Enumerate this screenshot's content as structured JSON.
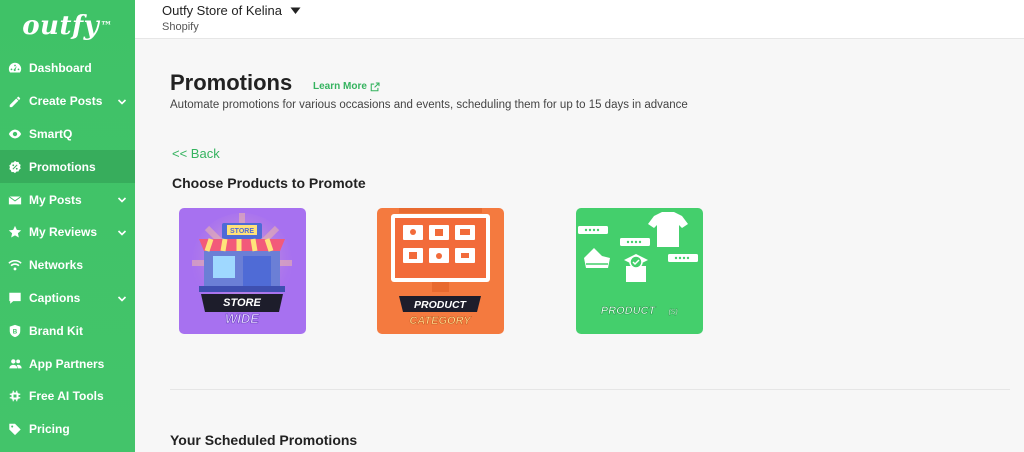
{
  "brand": {
    "logo_text": "outfy",
    "tm": "™"
  },
  "sidebar": {
    "items": [
      {
        "label": "Dashboard",
        "icon": "speedometer-icon",
        "has_chevron": false
      },
      {
        "label": "Create Posts",
        "icon": "pencil-icon",
        "has_chevron": true
      },
      {
        "label": "SmartQ",
        "icon": "smartq-icon",
        "has_chevron": false
      },
      {
        "label": "Promotions",
        "icon": "percent-badge-icon",
        "has_chevron": false,
        "active": true
      },
      {
        "label": "My Posts",
        "icon": "envelope-icon",
        "has_chevron": true
      },
      {
        "label": "My Reviews",
        "icon": "star-icon",
        "has_chevron": true
      },
      {
        "label": "Networks",
        "icon": "wifi-icon",
        "has_chevron": false
      },
      {
        "label": "Captions",
        "icon": "chat-icon",
        "has_chevron": true
      },
      {
        "label": "Brand Kit",
        "icon": "shield-icon",
        "has_chevron": false
      },
      {
        "label": "App Partners",
        "icon": "users-icon",
        "has_chevron": false
      },
      {
        "label": "Free AI Tools",
        "icon": "chip-icon",
        "has_chevron": false
      },
      {
        "label": "Pricing",
        "icon": "tag-icon",
        "has_chevron": false
      }
    ]
  },
  "topbar": {
    "store_name": "Outfy Store of Kelina",
    "platform": "Shopify"
  },
  "main": {
    "title": "Promotions",
    "learn_more": "Learn More",
    "subtitle": "Automate promotions for various occasions and events, scheduling them for up to 15 days in advance",
    "back": "<< Back",
    "section_heading": "Choose Products to Promote",
    "cards": [
      {
        "line1": "STORE",
        "line2": "WIDE",
        "sign": "STORE",
        "color": "#a771f0"
      },
      {
        "line1": "PRODUCT",
        "line2": "CATEGORY",
        "color": "#f47a3f"
      },
      {
        "line1": "PRODUCT",
        "line2": "(S)",
        "color": "#44cf6c"
      }
    ],
    "scheduled_heading": "Your Scheduled Promotions"
  },
  "colors": {
    "brand_green": "#3fc267",
    "active_green": "#37ad5c",
    "link_green": "#35b35f"
  }
}
